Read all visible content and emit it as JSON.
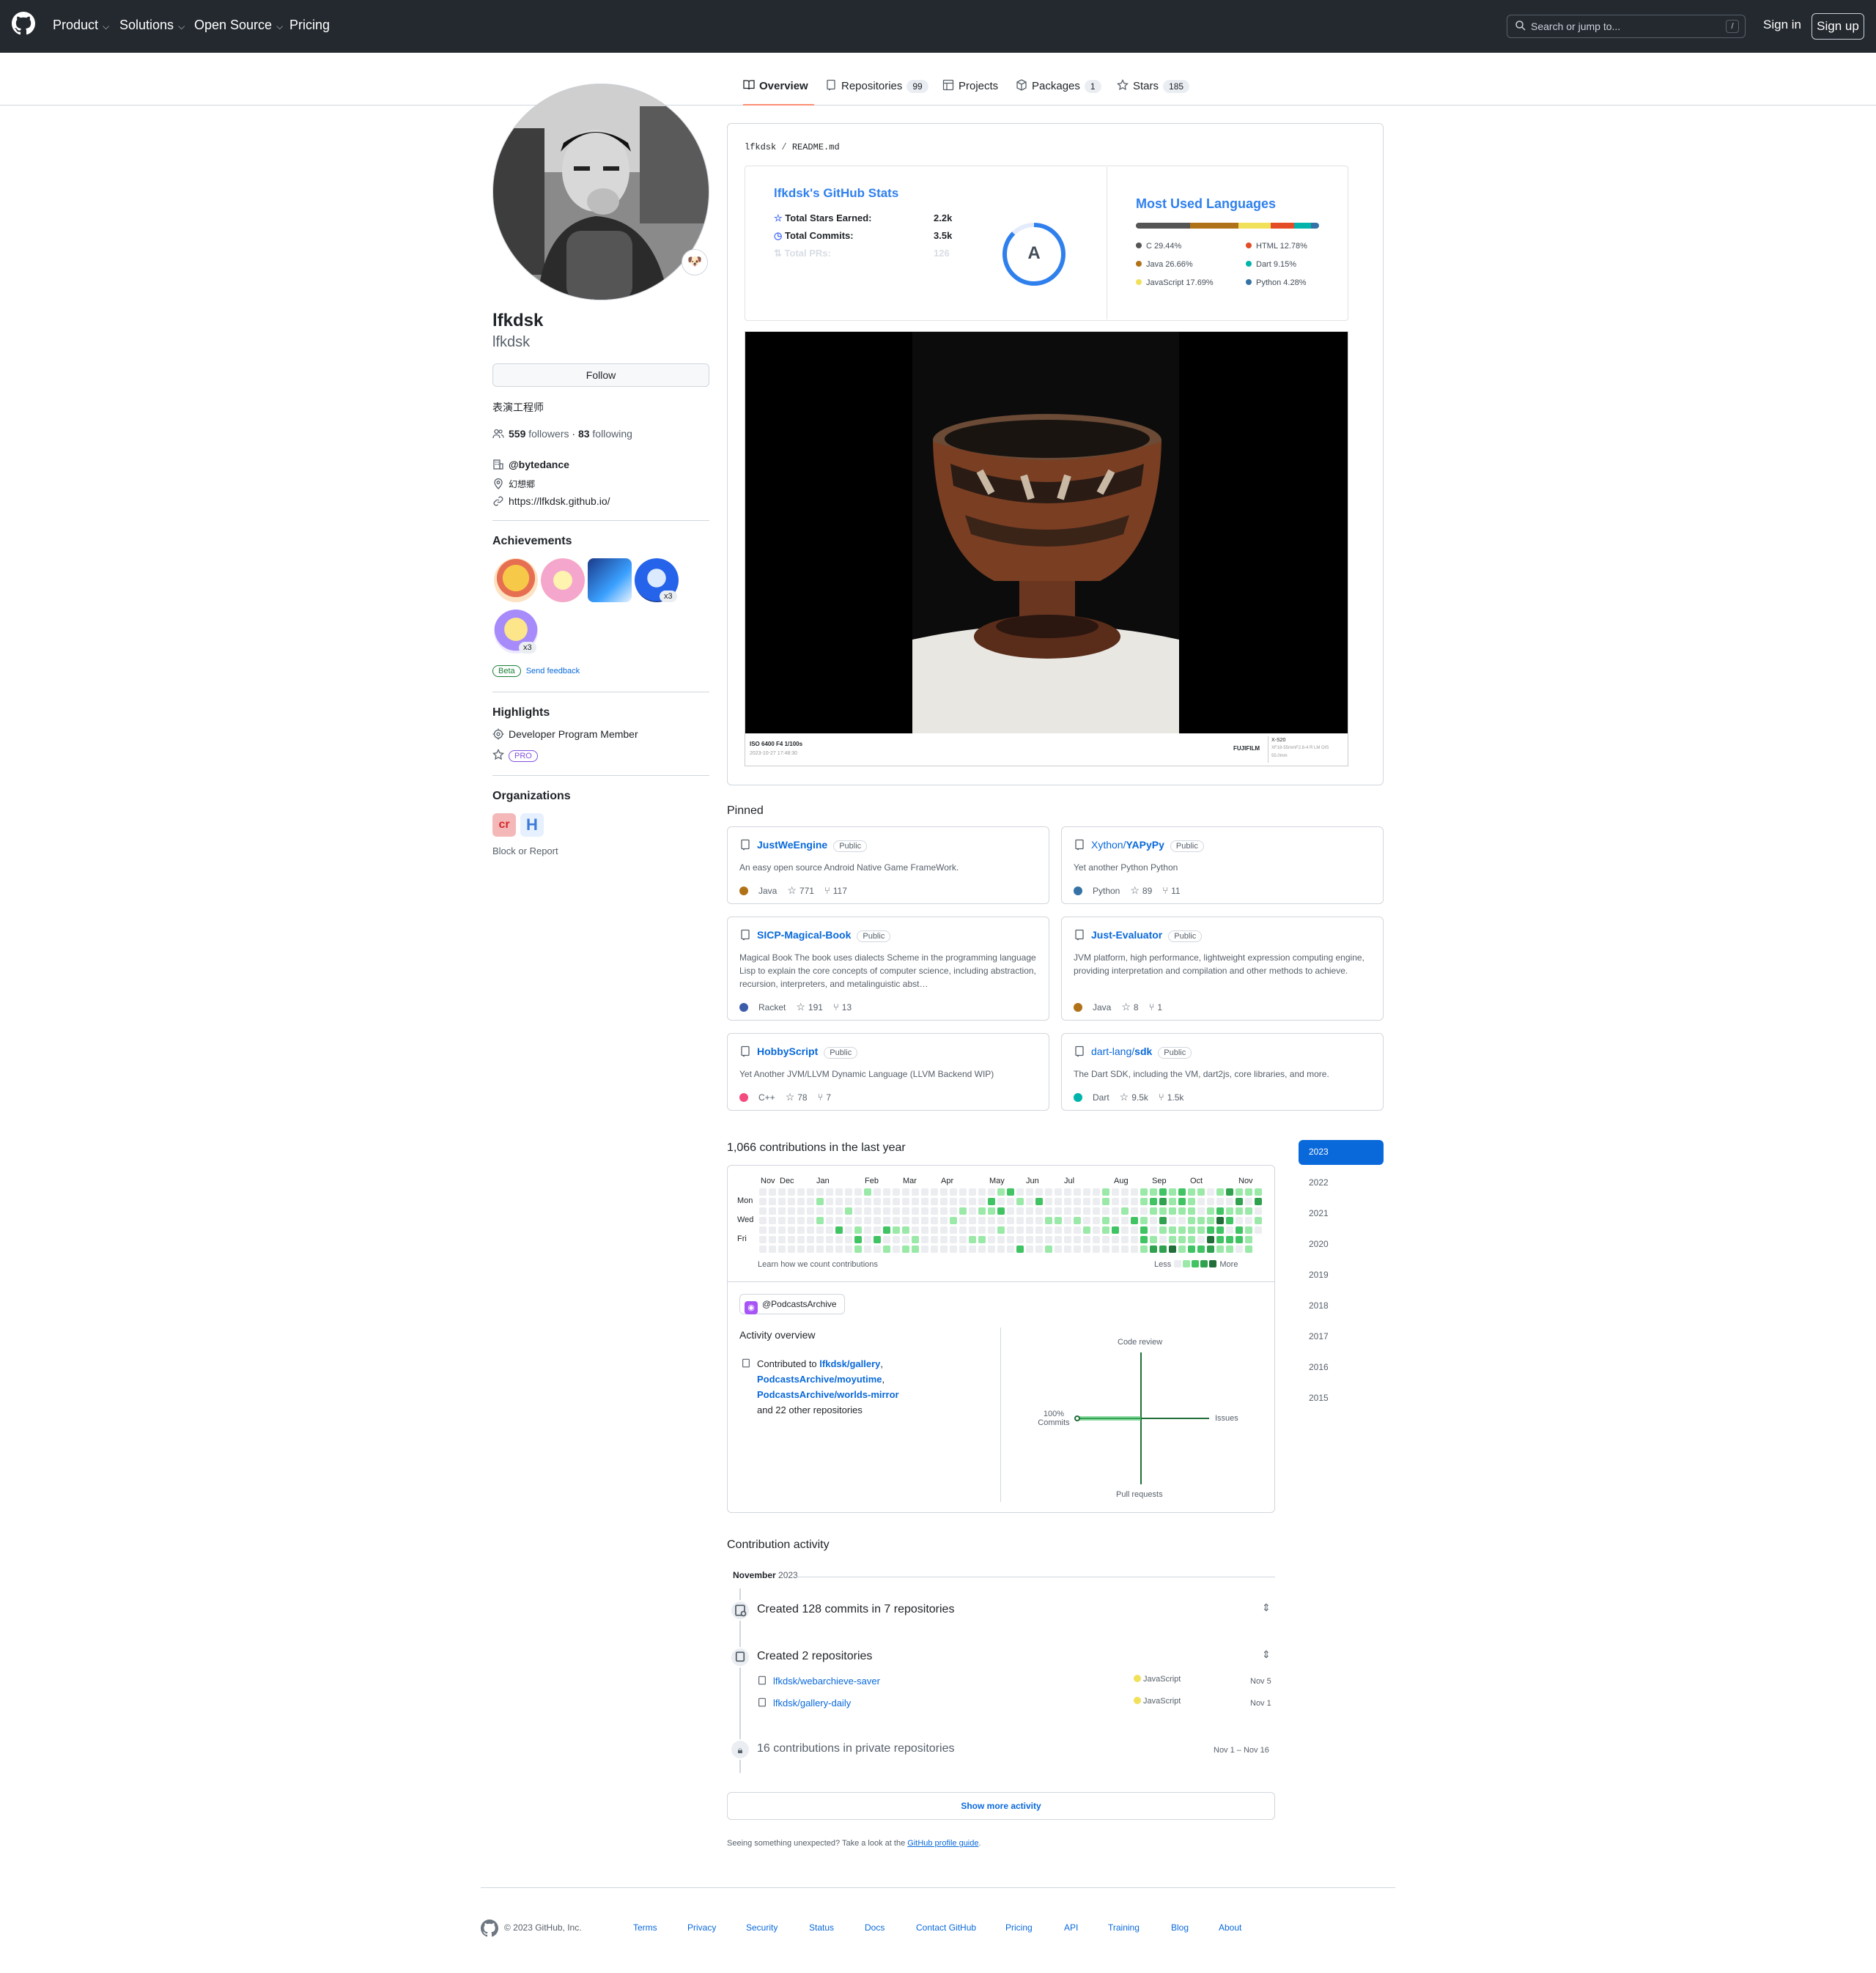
{
  "header": {
    "nav": [
      "Product",
      "Solutions",
      "Open Source",
      "Pricing"
    ],
    "search_placeholder": "Search or jump to...",
    "search_key": "/",
    "signin": "Sign in",
    "signup": "Sign up"
  },
  "tabs": [
    {
      "label": "Overview",
      "count": ""
    },
    {
      "label": "Repositories",
      "count": "99"
    },
    {
      "label": "Projects",
      "count": ""
    },
    {
      "label": "Packages",
      "count": "1"
    },
    {
      "label": "Stars",
      "count": "185"
    }
  ],
  "profile": {
    "fullname": "lfkdsk",
    "login": "lfkdsk",
    "follow": "Follow",
    "bio": "表演工程师",
    "followers": "559",
    "followers_label": "followers",
    "following": "83",
    "following_label": "following",
    "org": "@bytedance",
    "location": "幻想郷",
    "url": "https://lfkdsk.github.io/",
    "avatar_emoji": "🐶"
  },
  "achievements": {
    "title": "Achievements",
    "multipliers": [
      "x3",
      "x3"
    ],
    "beta": "Beta",
    "feedback": "Send feedback"
  },
  "highlights": {
    "title": "Highlights",
    "member": "Developer Program Member",
    "pro": "PRO"
  },
  "organizations": {
    "title": "Organizations",
    "block": "Block or Report"
  },
  "readme": {
    "path_user": "lfkdsk",
    "path_sep": "/",
    "path_file": "README.md",
    "stats": {
      "title": "lfkdsk's GitHub Stats",
      "rows": [
        {
          "label": "Total Stars Earned:",
          "value": "2.2k"
        },
        {
          "label": "Total Commits:",
          "value": "3.5k"
        },
        {
          "label": "Total PRs:",
          "value": "126"
        }
      ],
      "grade": "A"
    },
    "langs": {
      "title": "Most Used Languages",
      "items": [
        {
          "name": "C 29.44%",
          "color": "#555555"
        },
        {
          "name": "HTML 12.78%",
          "color": "#e34c26"
        },
        {
          "name": "Java 26.66%",
          "color": "#b07219"
        },
        {
          "name": "Dart 9.15%",
          "color": "#00b4ab"
        },
        {
          "name": "JavaScript 17.69%",
          "color": "#f1e05a"
        },
        {
          "name": "Python 4.28%",
          "color": "#3572a5"
        }
      ],
      "shares": [
        29.44,
        26.66,
        17.69,
        12.78,
        9.15,
        4.28
      ]
    },
    "photo": {
      "exif": "ISO 6400 F4 1/100s",
      "date": "2023-10-27 17:48:30",
      "brand": "FUJIFILM",
      "model": "X-S20",
      "lens": "XF18-55mmF2.8-4 R LM OIS",
      "focal": "55.0mm"
    }
  },
  "pinned": {
    "title": "Pinned",
    "public": "Public",
    "items": [
      {
        "owner": "",
        "name": "JustWeEngine",
        "desc": "An easy open source Android Native Game FrameWork.",
        "lang": "Java",
        "color": "#b07219",
        "stars": "771",
        "forks": "117"
      },
      {
        "owner": "Xython/",
        "name": "YAPyPy",
        "desc": "Yet another Python Python",
        "lang": "Python",
        "color": "#3572a5",
        "stars": "89",
        "forks": "11"
      },
      {
        "owner": "",
        "name": "SICP-Magical-Book",
        "desc": "Magical Book The book uses dialects Scheme in the programming language Lisp to explain the core concepts of computer science, including abstraction, recursion, interpreters, and metalinguistic abst…",
        "lang": "Racket",
        "color": "#3c5caa",
        "stars": "191",
        "forks": "13"
      },
      {
        "owner": "",
        "name": "Just-Evaluator",
        "desc": "JVM platform, high performance, lightweight expression computing engine, providing interpretation and compilation and other methods to achieve.",
        "lang": "Java",
        "color": "#b07219",
        "stars": "8",
        "forks": "1"
      },
      {
        "owner": "",
        "name": "HobbyScript",
        "desc": "Yet Another JVM/LLVM Dynamic Language (LLVM Backend WIP)",
        "lang": "C++",
        "color": "#f34b7d",
        "stars": "78",
        "forks": "7"
      },
      {
        "owner": "dart-lang/",
        "name": "sdk",
        "desc": "The Dart SDK, including the VM, dart2js, core libraries, and more.",
        "lang": "Dart",
        "color": "#00b4ab",
        "stars": "9.5k",
        "forks": "1.5k"
      }
    ]
  },
  "contributions": {
    "title": "1,066 contributions in the last year",
    "months": [
      "Nov",
      "Dec",
      "Jan",
      "Feb",
      "Mar",
      "Apr",
      "May",
      "Jun",
      "Jul",
      "Aug",
      "Sep",
      "Oct",
      "Nov"
    ],
    "days": [
      "Mon",
      "Wed",
      "Fri"
    ],
    "learn": "Learn how we count contributions",
    "less": "Less",
    "more": "More",
    "colors": [
      "#ebedf0",
      "#9be9a8",
      "#40c463",
      "#30a14e",
      "#216e39"
    ]
  },
  "years": [
    "2023",
    "2022",
    "2021",
    "2020",
    "2019",
    "2018",
    "2017",
    "2016",
    "2015"
  ],
  "activity": {
    "org": "@PodcastsArchive",
    "overview": "Activity overview",
    "contributed_to": "Contributed to",
    "repos": [
      "lfkdsk/gallery",
      "PodcastsArchive/moyutime",
      "PodcastsArchive/worlds-mirror"
    ],
    "others": "and 22 other repositories",
    "axis": {
      "top": "Code review",
      "right": "Issues",
      "bottom": "Pull requests",
      "left_pct": "100%",
      "left": "Commits"
    }
  },
  "timeline": {
    "title": "Contribution activity",
    "month": "November",
    "year": "2023",
    "commits": "Created 128 commits in 7 repositories",
    "created": "Created 2 repositories",
    "repos": [
      {
        "name": "lfkdsk/webarchieve-saver",
        "lang": "JavaScript",
        "date": "Nov 5"
      },
      {
        "name": "lfkdsk/gallery-daily",
        "lang": "JavaScript",
        "date": "Nov 1"
      }
    ],
    "private": "16 contributions in private repositories",
    "private_range": "Nov 1 – Nov 16",
    "show_more": "Show more activity",
    "unexpected": "Seeing something unexpected? Take a look at the",
    "guide": "GitHub profile guide",
    "period": "."
  },
  "footer": {
    "copy": "© 2023 GitHub, Inc.",
    "links": [
      "Terms",
      "Privacy",
      "Security",
      "Status",
      "Docs",
      "Contact GitHub",
      "Pricing",
      "API",
      "Training",
      "Blog",
      "About"
    ]
  }
}
